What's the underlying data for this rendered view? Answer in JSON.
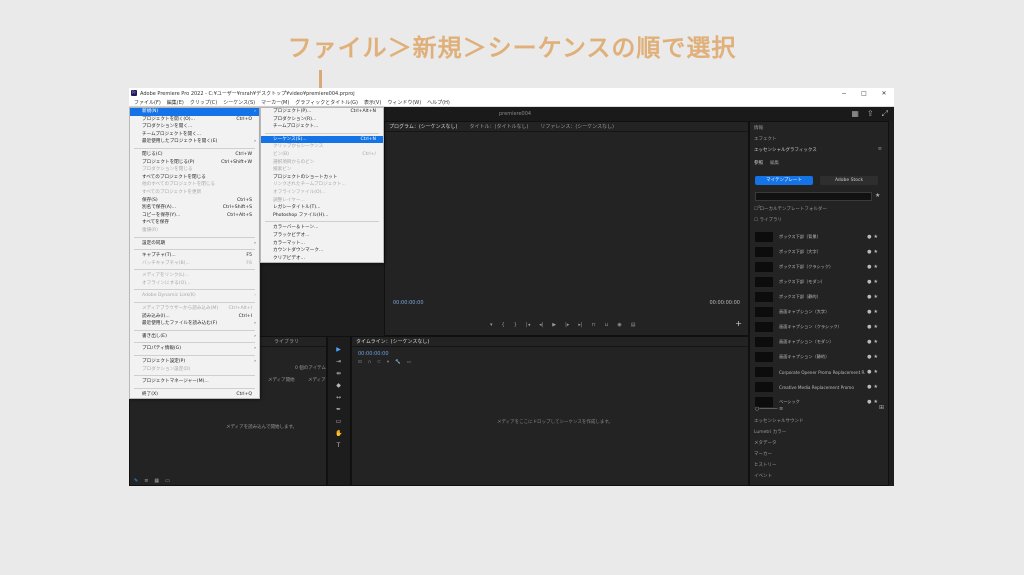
{
  "caption": "ファイル＞新規＞シーケンスの順で選択",
  "window": {
    "title": "Adobe Premiere Pro 2022 - C:¥ユーザー¥rsrah¥デスクトップ¥video¥premiere004.prproj",
    "controls": [
      "−",
      "□",
      "✕"
    ]
  },
  "menubar": [
    "ファイル(F)",
    "編集(E)",
    "クリップ(C)",
    "シーケンス(S)",
    "マーカー(M)",
    "グラフィックとタイトル(G)",
    "表示(V)",
    "ウィンドウ(W)",
    "ヘルプ(H)"
  ],
  "workspace_title": "premiere004",
  "source_tabs": [
    "プログラム：(シーケンスなし)",
    "タイトル：(タイトルなし)",
    "リファレンス：(シーケンスなし)"
  ],
  "program": {
    "tc_left": "00:00:00:00",
    "tc_right": "00:00:00:00"
  },
  "file_menu": [
    {
      "label": "新規(N)",
      "arrow": true,
      "hl": true
    },
    {
      "label": "プロジェクトを開く(O)...",
      "shortcut": "Ctrl+O"
    },
    {
      "label": "プロダクションを開く..."
    },
    {
      "label": "チームプロジェクトを開く..."
    },
    {
      "label": "最近使用したプロジェクトを開く(E)",
      "arrow": true
    },
    {
      "sep": true
    },
    {
      "label": "閉じる(C)",
      "shortcut": "Ctrl+W"
    },
    {
      "label": "プロジェクトを閉じる(P)",
      "shortcut": "Ctrl+Shift+W"
    },
    {
      "label": "プロダクションを閉じる",
      "dis": true
    },
    {
      "label": "すべてのプロジェクトを閉じる"
    },
    {
      "label": "他のすべてのプロジェクトを閉じる",
      "dis": true
    },
    {
      "label": "すべてのプロジェクトを更新",
      "dis": true
    },
    {
      "label": "保存(S)",
      "shortcut": "Ctrl+S"
    },
    {
      "label": "別名で保存(A)...",
      "shortcut": "Ctrl+Shift+S"
    },
    {
      "label": "コピーを保存(Y)...",
      "shortcut": "Ctrl+Alt+S"
    },
    {
      "label": "すべてを保存"
    },
    {
      "label": "復帰(R)",
      "dis": true
    },
    {
      "sep": true
    },
    {
      "label": "設定の同期",
      "arrow": true
    },
    {
      "sep": true
    },
    {
      "label": "キャプチャ(T)...",
      "shortcut": "F5"
    },
    {
      "label": "バッチキャプチャ(B)...",
      "shortcut": "F6",
      "dis": true
    },
    {
      "sep": true
    },
    {
      "label": "メディアをリンク(L)...",
      "dis": true
    },
    {
      "label": "オフラインにする(O)...",
      "dis": true
    },
    {
      "sep": true
    },
    {
      "label": "Adobe Dynamic Link(K)",
      "arrow": true,
      "dis": true
    },
    {
      "sep": true
    },
    {
      "label": "メディアブラウザーから読み込み(M)",
      "shortcut": "Ctrl+Alt+I",
      "dis": true
    },
    {
      "label": "読み込み(I)...",
      "shortcut": "Ctrl+I"
    },
    {
      "label": "最近使用したファイルを読み込む(F)",
      "arrow": true
    },
    {
      "sep": true
    },
    {
      "label": "書き出し(E)",
      "arrow": true
    },
    {
      "sep": true
    },
    {
      "label": "プロパティ情報(G)",
      "arrow": true
    },
    {
      "sep": true
    },
    {
      "label": "プロジェクト設定(P)",
      "arrow": true
    },
    {
      "label": "プロダクション設定(D)",
      "dis": true
    },
    {
      "sep": true
    },
    {
      "label": "プロジェクトマネージャー(M)..."
    },
    {
      "sep": true
    },
    {
      "label": "終了(X)",
      "shortcut": "Ctrl+Q"
    }
  ],
  "new_menu": [
    {
      "label": "プロジェクト(P)...",
      "shortcut": "Ctrl+Alt+N"
    },
    {
      "label": "プロダクション(R)..."
    },
    {
      "label": "チームプロジェクト..."
    },
    {
      "sep": true
    },
    {
      "label": "シーケンス(S)...",
      "shortcut": "Ctrl+N",
      "hl": true
    },
    {
      "label": "クリップからシーケンス",
      "dis": true
    },
    {
      "label": "ビン(B)",
      "shortcut": "Ctrl+/",
      "dis": true
    },
    {
      "label": "選択項目からのビン",
      "dis": true
    },
    {
      "label": "検索ビン",
      "dis": true
    },
    {
      "label": "プロジェクトのショートカット"
    },
    {
      "label": "リンクされたチームプロジェクト...",
      "dis": true
    },
    {
      "label": "オフラインファイル(O)...",
      "dis": true
    },
    {
      "label": "調整レイヤー...",
      "dis": true
    },
    {
      "label": "レガシータイトル(T)..."
    },
    {
      "label": "Photoshop ファイル(H)..."
    },
    {
      "sep": true
    },
    {
      "label": "カラーバー＆トーン..."
    },
    {
      "label": "ブラックビデオ..."
    },
    {
      "label": "カラーマット..."
    },
    {
      "label": "カウントダウンマーク..."
    },
    {
      "label": "クリアビデオ..."
    }
  ],
  "timeline": {
    "tab": "タイムライン：(シーケンスなし)",
    "timecode": "00:00:00:00",
    "empty_msg": "メディアをここにドロップしてシーケンスを作成します。"
  },
  "project": {
    "tab": "ライブラリ",
    "items_count": "0 個のアイテム",
    "col_media_start": "メディア開始",
    "col_media": "メディア",
    "empty_msg": "メディアを読み込んで開始します。"
  },
  "right_panel": {
    "tab_info": "情報",
    "tab_effects": "エフェクト",
    "title": "エッセンシャルグラフィックス",
    "sub_browse": "参照",
    "sub_edit": "編集",
    "btn_templates": "マイテンプレート",
    "btn_stock": "Adobe Stock",
    "chk_local": "ローカルテンプレートフォルダー",
    "chk_library": "ライブラリ",
    "items": [
      "ボックス下部（背景）",
      "ボックス下部（大字）",
      "ボックス下部（クラシック）",
      "ボックス下部（モダン）",
      "ボックス下部（静的）",
      "画面キャプション（大字）",
      "画面キャプション（クラシック）",
      "画面キャプション（モダン）",
      "画面キャプション（静的）",
      "Corporate Opener Promo Replacement R...",
      "Creative Media Replacement Promo",
      "ベーシック"
    ],
    "sections": [
      "エッセンシャルサウンド",
      "Lumetri カラー",
      "メタデータ",
      "マーカー",
      "ヒストリー",
      "イベント"
    ]
  }
}
